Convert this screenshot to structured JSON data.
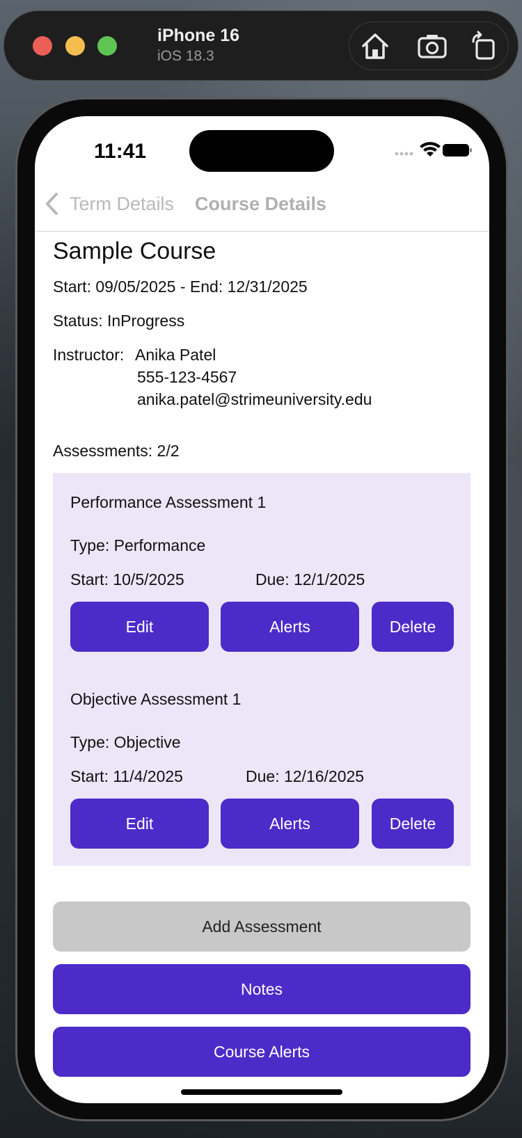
{
  "simulator": {
    "device_name": "iPhone 16",
    "os_version": "iOS 18.3",
    "icons": [
      "home-icon",
      "screenshot-icon",
      "rotate-icon"
    ]
  },
  "status_bar": {
    "time": "11:41"
  },
  "nav": {
    "back_label": "Term Details",
    "title": "Course Details"
  },
  "course": {
    "name": "Sample Course",
    "dates": "Start: 09/05/2025 - End: 12/31/2025",
    "status": "Status: InProgress",
    "instructor_label": "Instructor:",
    "instructor_name": "Anika Patel",
    "instructor_phone": "555-123-4567",
    "instructor_email": "anika.patel@strimeuniversity.edu",
    "assessments_count": "Assessments: 2/2"
  },
  "assessments": [
    {
      "name": "Performance Assessment 1",
      "type": "Type: Performance",
      "start": "Start: 10/5/2025",
      "due": "Due: 12/1/2025",
      "edit_label": "Edit",
      "alerts_label": "Alerts",
      "delete_label": "Delete"
    },
    {
      "name": "Objective Assessment 1",
      "type": "Type: Objective",
      "start": "Start: 11/4/2025",
      "due": "Due: 12/16/2025",
      "edit_label": "Edit",
      "alerts_label": "Alerts",
      "delete_label": "Delete"
    }
  ],
  "actions": {
    "add_assessment": "Add Assessment",
    "notes": "Notes",
    "course_alerts": "Course Alerts"
  },
  "colors": {
    "accent": "#4c2bc9",
    "assessment_bg": "#ede6f8",
    "add_button_bg": "#c8c8c8"
  }
}
